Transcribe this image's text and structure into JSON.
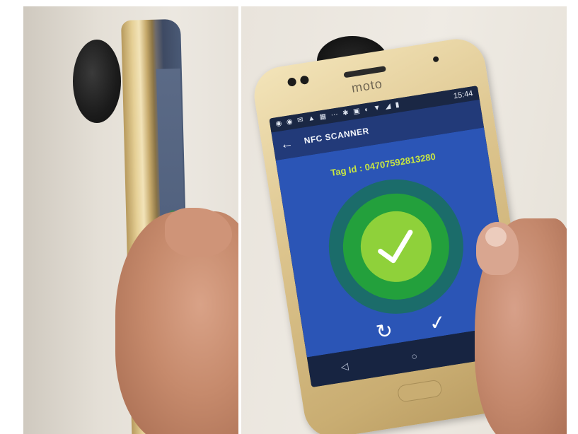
{
  "scene": {
    "left_photo": "side-view",
    "right_photo": "front-view"
  },
  "phone": {
    "brand_logo": "moto",
    "status_bar": {
      "time": "15:44"
    },
    "app": {
      "title": "NFC SCANNER",
      "tag_id_label": "Tag Id : 04707592813280",
      "result_icon": "check-icon",
      "actions": [
        "refresh-icon",
        "check-icon"
      ],
      "nav": [
        "back-triangle-icon",
        "home-circle-icon",
        "recents-square-icon"
      ]
    }
  },
  "colors": {
    "accent_green": "#8fd13a",
    "tag_id_color": "#c8e642",
    "app_bar": "#223a79",
    "content_bg": "#2b55b6"
  }
}
